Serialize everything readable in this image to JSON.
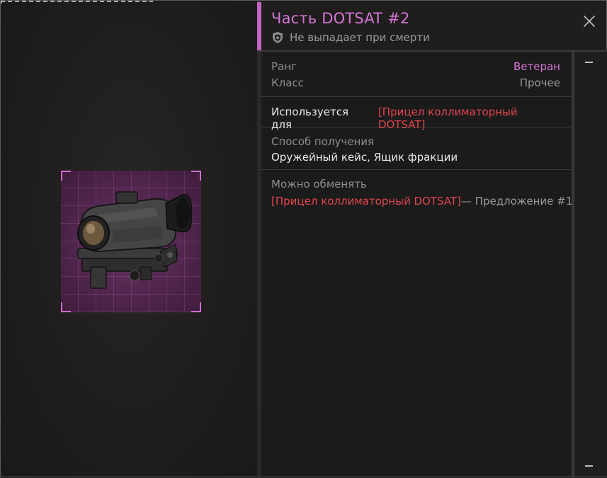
{
  "item": {
    "title": "Часть DOTSAT #2",
    "death_note": "Не выпадает при смерти",
    "icon": "shield-icon"
  },
  "stats": {
    "rank_label": "Ранг",
    "rank_value": "Ветеран",
    "class_label": "Класс",
    "class_value": "Прочее"
  },
  "usage": {
    "label": "Используется для",
    "link": "[Прицел коллиматорный DOTSAT]"
  },
  "obtain": {
    "label": "Способ получения",
    "value": "Оружейный кейс, Ящик фракции"
  },
  "exchange": {
    "label": "Можно обменять",
    "link": "[Прицел коллиматорный DOTSAT]",
    "suffix": " — Предложение #1"
  },
  "colors": {
    "accent": "#d574d8",
    "link": "#e0454f",
    "background": "#1c1b1b"
  }
}
